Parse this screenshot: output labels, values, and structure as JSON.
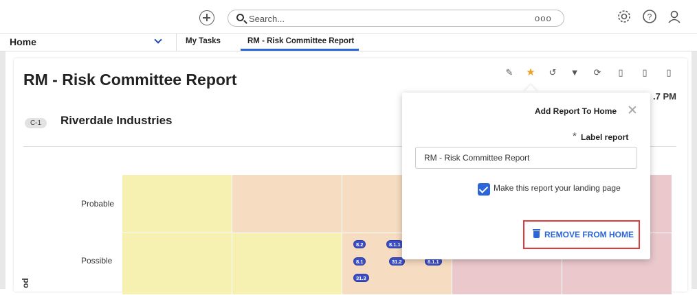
{
  "header": {
    "search_placeholder": "Search...",
    "more_label": "ooo"
  },
  "tabs": {
    "home_label": "Home",
    "items": [
      "My Tasks",
      "RM - Risk Committee Report"
    ]
  },
  "report": {
    "title": "RM - Risk Committee Report",
    "time_fragment": ".7 PM",
    "entity_code": "C-1",
    "entity_name": "Riverdale Industries"
  },
  "heatmap": {
    "row_labels": [
      "Probable",
      "Possible"
    ],
    "axis_fragment": "od",
    "colors": {
      "yellow": "#f6f1b0",
      "orange": "#f6dcc0",
      "pink": "#eac8cc"
    },
    "pills": [
      "8.2",
      "8.1.1",
      "8.1",
      "31.2",
      "8.1.1",
      "31.3"
    ]
  },
  "popover": {
    "title": "Add Report To Home",
    "required_mark": "*",
    "field_label": "Label report",
    "field_value": "RM - Risk Committee Report",
    "checkbox_label": "Make this report your landing page",
    "checkbox_checked": true,
    "remove_label": "REMOVE FROM HOME"
  },
  "colors": {
    "accent": "#2a66d9",
    "highlight_border": "#e03b3b",
    "pill": "#3c4fc6"
  }
}
